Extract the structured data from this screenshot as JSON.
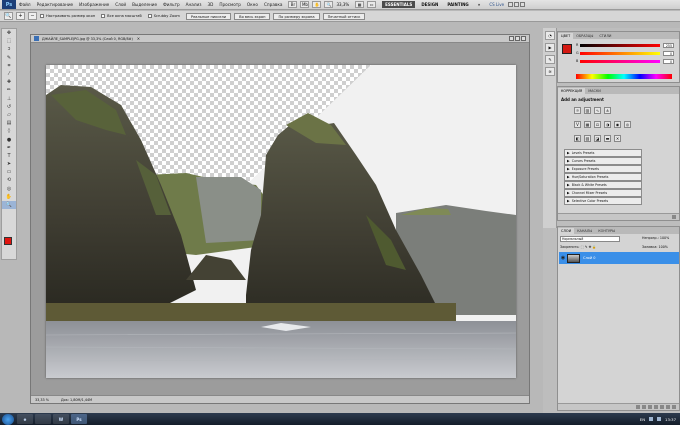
{
  "menu": {
    "logo": "Ps",
    "items": [
      "Файл",
      "Редактирование",
      "Изображение",
      "Слой",
      "Выделение",
      "Фильтр",
      "Анализ",
      "3D",
      "Просмотр",
      "Окно",
      "Справка"
    ],
    "zoom": "33,3%",
    "workspaces": [
      "ESSENTIALS",
      "DESIGN",
      "PAINTING"
    ],
    "active_workspace": "ESSENTIALS",
    "more": "»",
    "cslive": "CS Live"
  },
  "options": {
    "checkboxes": [
      "Настраивать размер окон",
      "Все окна масштаб",
      "Scrubby Zoom"
    ],
    "buttons": [
      "Реальные пиксели",
      "Во весь экран",
      "По размеру экрана",
      "Печатный оттиск"
    ]
  },
  "document": {
    "tab_title": "ДЖАЙЛЕ_SAMPLEJPG.jpg @ 33,3% (Слой 0, RGB/8#)",
    "zoom": "33,33 %",
    "doc_info": "Док: 1,80М/1,44М"
  },
  "color_panel": {
    "tabs": [
      "ЦВЕТ",
      "ОБРАЗЦЫ",
      "СТИЛИ"
    ],
    "channels": [
      {
        "label": "R",
        "value": "255"
      },
      {
        "label": "G",
        "value": "0"
      },
      {
        "label": "B",
        "value": "0"
      }
    ],
    "fg_color": "#d41912"
  },
  "adjustments": {
    "tabs": [
      "КОРРЕКЦИЯ",
      "МАСКИ"
    ],
    "title": "Add an adjustment",
    "presets": [
      "Levels Presets",
      "Curves Presets",
      "Exposure Presets",
      "Hue/Saturation Presets",
      "Black & White Presets",
      "Channel Mixer Presets",
      "Selective Color Presets"
    ]
  },
  "layers": {
    "tabs": [
      "СЛОИ",
      "КАНАЛЫ",
      "КОНТУРЫ"
    ],
    "blend": "Нормальный",
    "opacity_label": "Непрозр.:",
    "opacity": "100%",
    "lock_label": "Закрепить:",
    "fill_label": "Заливка:",
    "fill": "100%",
    "items": [
      {
        "name": "Слой 0"
      }
    ]
  },
  "taskbar": {
    "apps": [
      "e",
      "",
      "W",
      "Ps"
    ],
    "lang": "EN",
    "time": "13:37"
  },
  "colors": {
    "accent": "#3a8fe8",
    "fg": "#e0140f"
  }
}
